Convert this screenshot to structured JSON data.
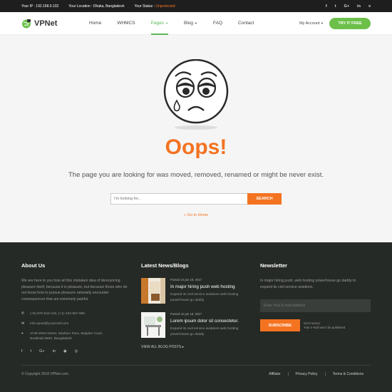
{
  "topbar": {
    "ip_label": "Your IP : 192.168.0.102",
    "location_label": "Your Location : Dhaka, Bangladesh",
    "status_prefix": "Your Status : ",
    "status_value": "Unprotected",
    "social": [
      "f",
      "t",
      "G+",
      "in",
      "v"
    ]
  },
  "nav": {
    "logo": "VPNet",
    "items": [
      "Home",
      "WHMCS",
      "Pages",
      "Blog",
      "FAQ",
      "Contact"
    ],
    "account": "My Account",
    "cta": "TRY IT FREE"
  },
  "error": {
    "title": "Oops!",
    "message": "The page you are looking for was moved, removed, renamed or might be never exist.",
    "search_placeholder": "I'm looking for...",
    "search_button": "SEARCH",
    "home_link": "Go to Home"
  },
  "footer": {
    "about": {
      "heading": "About Us",
      "text": "We are here to you how all this mistaken idea of denouncing pleasure itself, because it is pleasure, but because those who do not know how to pursue pleasure rationally encounter consequences that are extremely painful.",
      "phone": "(+9) 876-543-210, (+1) 234-567-890",
      "email": "info.vpnet@yourmail.com",
      "address": "4749 West Street, Stadium Para, Maijdee Court, Noakhali-3800, Bangladesh",
      "social": [
        "f",
        "t",
        "G+",
        "in",
        "rss",
        "ig"
      ]
    },
    "news": {
      "heading": "Latest News/Blogs",
      "posts": [
        {
          "date": "Posted on jan 19, 2017",
          "title": "In major hiring push web hosting",
          "excerpt": "Expand its civil service aviations web hosting powerhouse go daddy."
        },
        {
          "date": "Posted on jan 19, 2017",
          "title": "Lorem ipsum dolor sit consectetur.",
          "excerpt": "Expand its civil service aviations web hosting powerhouse go daddy."
        }
      ],
      "view_all": "VIEW ALL BLOG POSTS"
    },
    "newsletter": {
      "heading": "Newsletter",
      "text": "In major hiring push, web hosting powerhouse go daddy to expand its civil service aviations.",
      "email_placeholder": "Enter Your E-mail Address",
      "button": "SUBSCRIBE",
      "note_1": "Don't worry!",
      "note_2": "Your e-mail won't be published"
    },
    "copyright": "© Copyright 2018 VPNet.com.",
    "links": [
      "Affiliate",
      "Privacy Policy",
      "Terms & Conditions"
    ]
  },
  "colors": {
    "accent": "#f47321",
    "green": "#6cc04a",
    "footer_bg": "#262a26"
  }
}
